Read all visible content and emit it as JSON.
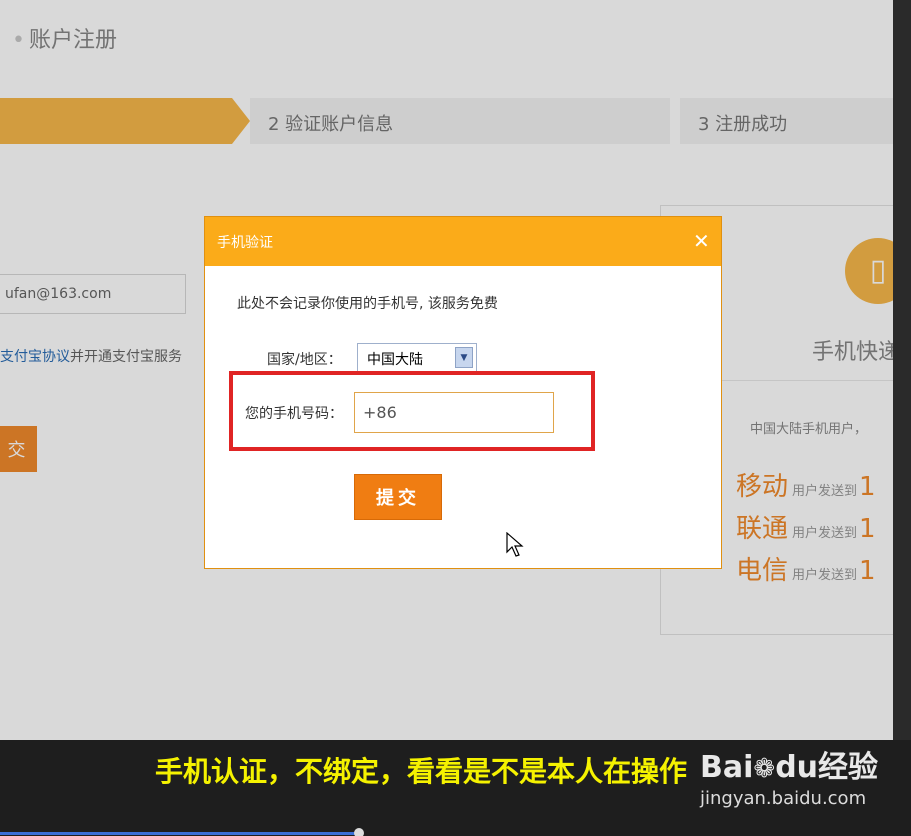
{
  "page": {
    "title": "账户注册"
  },
  "steps": [
    {
      "label": ""
    },
    {
      "label": "2 验证账户信息"
    },
    {
      "label": "3 注册成功"
    }
  ],
  "form": {
    "email_value": "ufan@163.com",
    "agree_link": "支付宝协议",
    "agree_text": "并开通支付宝服务",
    "submit_label": "交"
  },
  "right_card": {
    "icon": "phone-icon",
    "title": "手机快递",
    "note": "中国大陆手机用户，",
    "carriers": [
      {
        "name": "移动",
        "send_text": "用户发送到",
        "number": "1"
      },
      {
        "name": "联通",
        "send_text": "用户发送到",
        "number": "1"
      },
      {
        "name": "电信",
        "send_text": "用户发送到",
        "number": "1"
      }
    ]
  },
  "dialog": {
    "title": "手机验证",
    "close_icon": "close-icon",
    "info_text": "此处不会记录你使用的手机号, 该服务免费",
    "country_label": "国家/地区：",
    "country_value": "中国大陆",
    "phone_label": "您的手机号码：",
    "phone_value": "+86",
    "submit_label": "提交"
  },
  "caption": {
    "subtitle": "手机认证，不绑定，看看是不是本人在操作",
    "watermark_logo": "Bai",
    "watermark_logo_tail": "du经验",
    "watermark_url": "jingyan.baidu.com"
  },
  "colors": {
    "accent": "#fbab19",
    "button": "#f07d12",
    "highlight": "#e02424",
    "subtitle": "#f5f200"
  }
}
